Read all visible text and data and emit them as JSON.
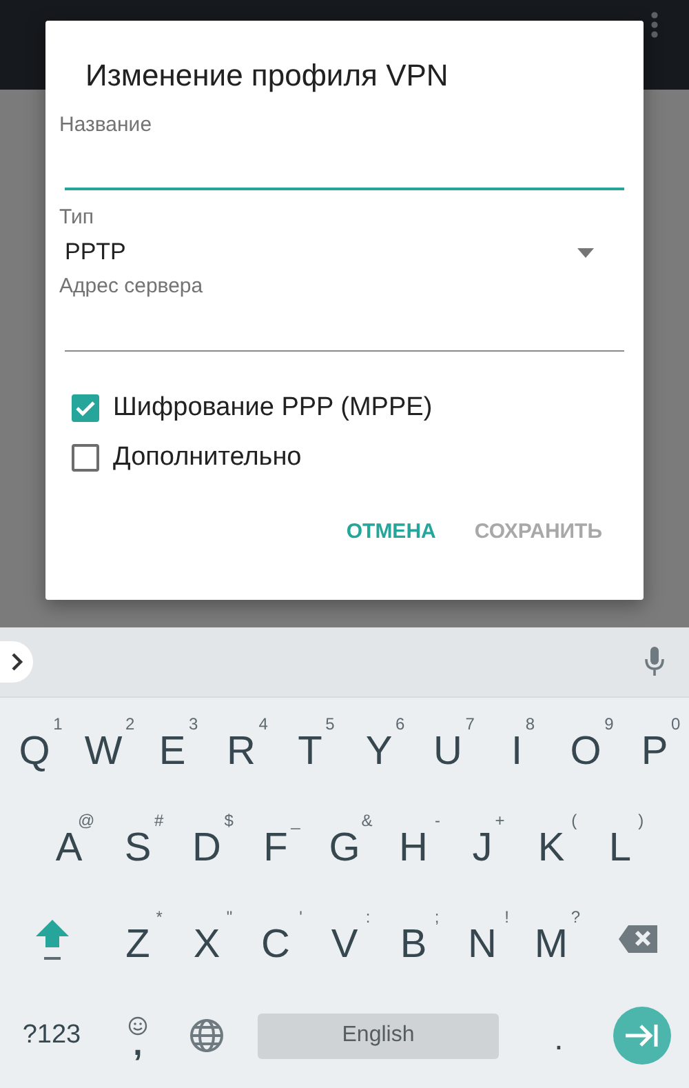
{
  "dialog": {
    "title": "Изменение профиля VPN",
    "fields": [
      {
        "kind": "text",
        "label": "Название",
        "focused": true
      },
      {
        "kind": "dropdown",
        "label": "Тип",
        "value": "PPTP"
      },
      {
        "kind": "text",
        "label": "Адрес сервера",
        "focused": false
      }
    ],
    "checkboxes": [
      {
        "label": "Шифрование PPP (MPPE)",
        "checked": true
      },
      {
        "label": "Дополнительно",
        "checked": false
      }
    ],
    "buttons": [
      {
        "label": "ОТМЕНА",
        "disabled": false
      },
      {
        "label": "СОХРАНИТЬ",
        "disabled": true
      }
    ]
  },
  "keyboard": {
    "shift_on": true,
    "rows": [
      {
        "keys": [
          {
            "kind": "letter",
            "label": "Q",
            "hint": "1"
          },
          {
            "kind": "letter",
            "label": "W",
            "hint": "2"
          },
          {
            "kind": "letter",
            "label": "E",
            "hint": "3"
          },
          {
            "kind": "letter",
            "label": "R",
            "hint": "4"
          },
          {
            "kind": "letter",
            "label": "T",
            "hint": "5"
          },
          {
            "kind": "letter",
            "label": "Y",
            "hint": "6"
          },
          {
            "kind": "letter",
            "label": "U",
            "hint": "7"
          },
          {
            "kind": "letter",
            "label": "I",
            "hint": "8"
          },
          {
            "kind": "letter",
            "label": "O",
            "hint": "9"
          },
          {
            "kind": "letter",
            "label": "P",
            "hint": "0"
          }
        ]
      },
      {
        "keys": [
          {
            "kind": "letter",
            "label": "A",
            "hint": "@"
          },
          {
            "kind": "letter",
            "label": "S",
            "hint": "#"
          },
          {
            "kind": "letter",
            "label": "D",
            "hint": "$"
          },
          {
            "kind": "letter",
            "label": "F",
            "hint": "_"
          },
          {
            "kind": "letter",
            "label": "G",
            "hint": "&"
          },
          {
            "kind": "letter",
            "label": "H",
            "hint": "-"
          },
          {
            "kind": "letter",
            "label": "J",
            "hint": "+"
          },
          {
            "kind": "letter",
            "label": "K",
            "hint": "("
          },
          {
            "kind": "letter",
            "label": "L",
            "hint": ")"
          }
        ]
      },
      {
        "keys": [
          {
            "kind": "shift"
          },
          {
            "kind": "letter",
            "label": "Z",
            "hint": "*"
          },
          {
            "kind": "letter",
            "label": "X",
            "hint": "\""
          },
          {
            "kind": "letter",
            "label": "C",
            "hint": "'"
          },
          {
            "kind": "letter",
            "label": "V",
            "hint": ":"
          },
          {
            "kind": "letter",
            "label": "B",
            "hint": ";"
          },
          {
            "kind": "letter",
            "label": "N",
            "hint": "!"
          },
          {
            "kind": "letter",
            "label": "M",
            "hint": "?"
          },
          {
            "kind": "backspace"
          }
        ]
      },
      {
        "keys": [
          {
            "kind": "symbols",
            "label": "?123"
          },
          {
            "kind": "comma",
            "label": ","
          },
          {
            "kind": "globe"
          },
          {
            "kind": "space",
            "label": "English"
          },
          {
            "kind": "period",
            "label": "."
          },
          {
            "kind": "enter"
          }
        ]
      }
    ]
  }
}
